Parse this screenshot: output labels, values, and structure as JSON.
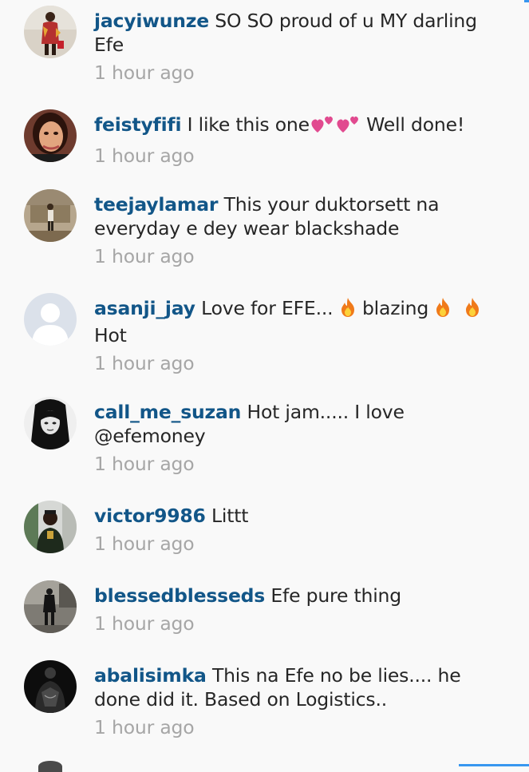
{
  "colors": {
    "background": "#f9f9f9",
    "username": "#125688",
    "text": "#262626",
    "timestamp": "#a6a6a6",
    "accent": "#3897f0"
  },
  "comments": [
    {
      "username": "jacyiwunze",
      "text": "SO SO proud of u MY darling Efe",
      "time": "1 hour ago"
    },
    {
      "username": "feistyfifi",
      "text_before": "I like this one",
      "emojis": [
        "two-hearts-emoji",
        "two-hearts-emoji"
      ],
      "text_after": " Well done!",
      "time": "1 hour ago"
    },
    {
      "username": "teejaylamar",
      "text": "This your duktorsett na everyday e dey wear blackshade",
      "time": "1 hour ago"
    },
    {
      "username": "asanji_jay",
      "text_1": "Love for EFE... ",
      "text_2": " blazing ",
      "text_3": "Hot",
      "emojis": [
        "fire-emoji",
        "fire-emoji",
        "fire-emoji"
      ],
      "time": "1 hour ago"
    },
    {
      "username": "call_me_suzan",
      "text": "Hot jam..... I love @efemoney",
      "time": "1 hour ago"
    },
    {
      "username": "victor9986",
      "text": "Littt",
      "time": "1 hour ago"
    },
    {
      "username": "blessedblesseds",
      "text": "Efe pure thing",
      "time": "1 hour ago"
    },
    {
      "username": "abalisimka",
      "text": "This na Efe no be lies.... he done did it. Based on Logistics..",
      "time": "1 hour ago"
    }
  ]
}
